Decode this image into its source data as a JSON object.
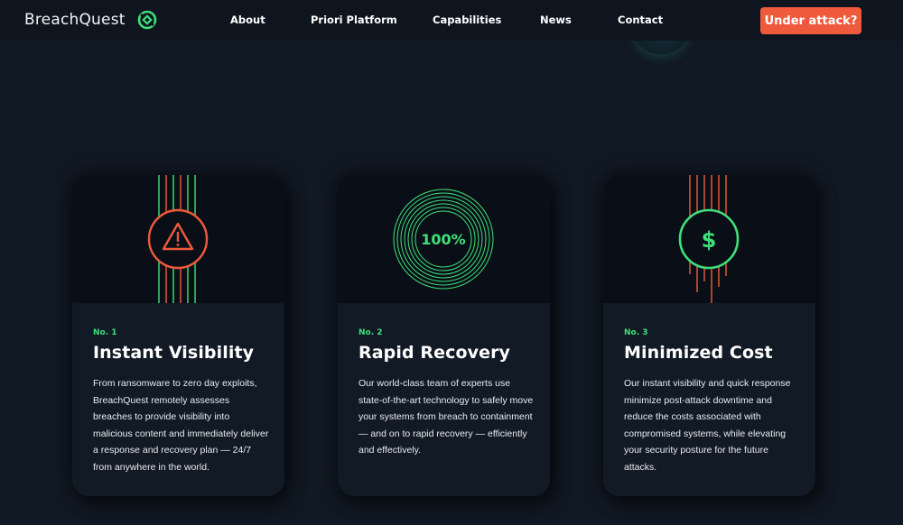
{
  "brand": {
    "name": "BreachQuest",
    "accent_green": "#3fe07a",
    "accent_orange": "#f05a3c"
  },
  "nav": {
    "items": [
      "About",
      "Priori Platform",
      "Capabilities",
      "News",
      "Contact"
    ],
    "cta_label": "Under attack?"
  },
  "cards": [
    {
      "number": "No. 1",
      "title": "Instant Visibility",
      "body": "From ransomware to zero day exploits, BreachQuest remotely assesses breaches to provide visibility into malicious content and immediately deliver a response and recovery plan — 24/7 from anywhere in the world.",
      "icon": "warning-triangle-icon"
    },
    {
      "number": "No. 2",
      "title": "Rapid Recovery",
      "body": "Our world-class team of experts use state-of-the-art technology to safely move your systems from breach to containment — and on to rapid recovery — efficiently and effectively.",
      "icon": "concentric-circles-icon",
      "graphic_label": "100%"
    },
    {
      "number": "No. 3",
      "title": "Minimized Cost",
      "body": "Our instant visibility and quick response minimize post-attack downtime and reduce the costs associated with compromised systems, while elevating your security posture for the future attacks.",
      "icon": "dollar-sign-icon",
      "graphic_label": "$"
    }
  ]
}
